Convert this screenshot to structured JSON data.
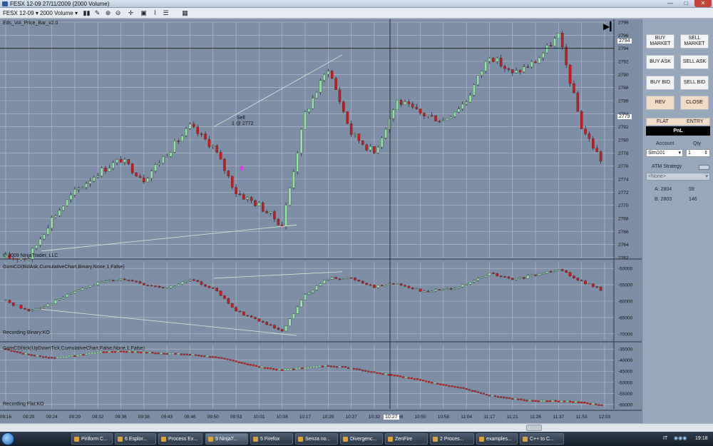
{
  "window": {
    "title": "FESX 12-09  27/11/2009 (2000 Volume)",
    "minimize": "—",
    "maximize": "□",
    "close": "✕"
  },
  "toolbar": {
    "instrument": "FESX 12-09",
    "interval": "2000 Volume",
    "icons": [
      "bar-type-icon",
      "draw-icon",
      "zoom-in-icon",
      "zoom-out-icon",
      "crosshair-icon",
      "properties-icon",
      "indicators-icon",
      "strategies-icon",
      "data-box-icon"
    ]
  },
  "chart": {
    "indicator_title": "Eds_Vol_Price_Bar_v2.0",
    "copyright": "© 2009 NinjaTrader, LLC",
    "panel2_title": "GomCD(BidAsk,CumulativeChart,Binary,None,1,False)",
    "panel2_status": "Recording Binary:KO",
    "panel3_title": "GomCD(tick(UpDownTick,CumulativeChart,False,None,1,False)",
    "panel3_status": "Recording Flat:KO",
    "sell_marker_label": "Sell",
    "sell_marker_detail": "1 @ 2772",
    "last_price": "2794",
    "current_price": "2779",
    "crosshair_time": "10:27",
    "colors": {
      "background": "#7e8ea6",
      "up": "#8fe6a0",
      "down": "#cc1a1a",
      "grid": "#b8c2d0"
    }
  },
  "chart_data": [
    {
      "type": "bar",
      "title": "Eds_Vol_Price_Bar_v2.0",
      "ylim": [
        2762,
        2798
      ],
      "yticks": [
        2762,
        2764,
        2766,
        2768,
        2770,
        2772,
        2774,
        2776,
        2778,
        2780,
        2782,
        2784,
        2786,
        2788,
        2790,
        2792,
        2794,
        2796,
        2798
      ],
      "x": [
        "09:16",
        "09:20",
        "09:24",
        "09:29",
        "09:32",
        "09:36",
        "09:38",
        "09:43",
        "09:46",
        "09:50",
        "09:53",
        "10:01",
        "10:08",
        "10:17",
        "10:20",
        "10:27",
        "10:32",
        "10:36",
        "10:50",
        "10:58",
        "11:04",
        "11:17",
        "11:21",
        "11:26",
        "11:37",
        "11:53",
        "12:03"
      ],
      "close": [
        2762,
        2762,
        2768,
        2772,
        2775,
        2777,
        2774,
        2778,
        2782,
        2779,
        2772,
        2770,
        2767,
        2784,
        2791,
        2781,
        2778,
        2786,
        2784,
        2783,
        2786,
        2793,
        2790,
        2792,
        2796,
        2782,
        2776
      ]
    },
    {
      "type": "bar",
      "title": "GomCD(BidAsk,CumulativeChart,Binary,None,1,False)",
      "ylim": [
        -72000,
        -48000
      ],
      "yticks": [
        -50000,
        -55000,
        -60000,
        -65000,
        -70000
      ],
      "x": [
        "09:16",
        "09:20",
        "09:24",
        "09:29",
        "09:32",
        "09:36",
        "09:38",
        "09:43",
        "09:46",
        "09:50",
        "09:53",
        "10:01",
        "10:08",
        "10:17",
        "10:20",
        "10:27",
        "10:32",
        "10:36",
        "10:50",
        "10:58",
        "11:04",
        "11:17",
        "11:21",
        "11:26",
        "11:37",
        "11:53",
        "12:03"
      ],
      "close": [
        -60000,
        -63000,
        -60500,
        -57000,
        -54500,
        -53000,
        -55000,
        -56000,
        -53500,
        -56000,
        -63000,
        -66000,
        -69500,
        -58000,
        -53000,
        -53000,
        -55500,
        -54500,
        -57000,
        -56500,
        -55000,
        -51500,
        -53500,
        -52000,
        -50000,
        -54000,
        -57000
      ]
    },
    {
      "type": "line",
      "title": "GomCD(tick(UpDownTick,CumulativeChart,False,None,1,False)",
      "ylim": [
        -62000,
        -33000
      ],
      "yticks": [
        -35000,
        -40000,
        -45000,
        -50000,
        -55000,
        -60000
      ],
      "x": [
        "09:16",
        "09:20",
        "09:24",
        "09:29",
        "09:32",
        "09:36",
        "09:38",
        "09:43",
        "09:46",
        "09:50",
        "09:53",
        "10:01",
        "10:08",
        "10:17",
        "10:20",
        "10:27",
        "10:32",
        "10:36",
        "10:50",
        "10:58",
        "11:04",
        "11:17",
        "11:21",
        "11:26",
        "11:37",
        "11:53",
        "12:03"
      ],
      "values": [
        -35000,
        -37500,
        -39000,
        -38000,
        -36500,
        -36000,
        -36500,
        -37000,
        -37500,
        -38500,
        -40500,
        -43000,
        -44500,
        -43500,
        -42500,
        -43500,
        -45500,
        -47000,
        -49000,
        -51000,
        -53000,
        -56000,
        -57500,
        -58500,
        -58500,
        -59000,
        -60500
      ]
    }
  ],
  "order_panel": {
    "buy_market": "BUY MARKET",
    "sell_market": "SELL MARKET",
    "buy_ask": "BUY ASK",
    "sell_ask": "SELL ASK",
    "buy_bid": "BUY BID",
    "sell_bid": "SELL BID",
    "rev": "REV",
    "close": "CLOSE",
    "flat": "FLAT",
    "entry": "ENTRY",
    "pnl": "PnL",
    "account_label": "Account",
    "qty_label": "Qty",
    "account_value": "Sim101",
    "qty_value": "1",
    "atm_label": "ATM Strategy",
    "atm_value": "<None>",
    "ask_label": "A: 2804",
    "ask_size": "59",
    "bid_label": "B: 2803",
    "bid_size": "146"
  },
  "taskbar": {
    "tasks": [
      "Piriform C...",
      "6 Esplor...",
      "Process Ex...",
      "9 NinjaT...",
      "5 Firefox",
      "Senza no...",
      "Divergenc...",
      "ZenFire",
      "2 Proces...",
      "examples...",
      "C++ to C..."
    ],
    "lang": "IT",
    "clock": "19:18"
  }
}
